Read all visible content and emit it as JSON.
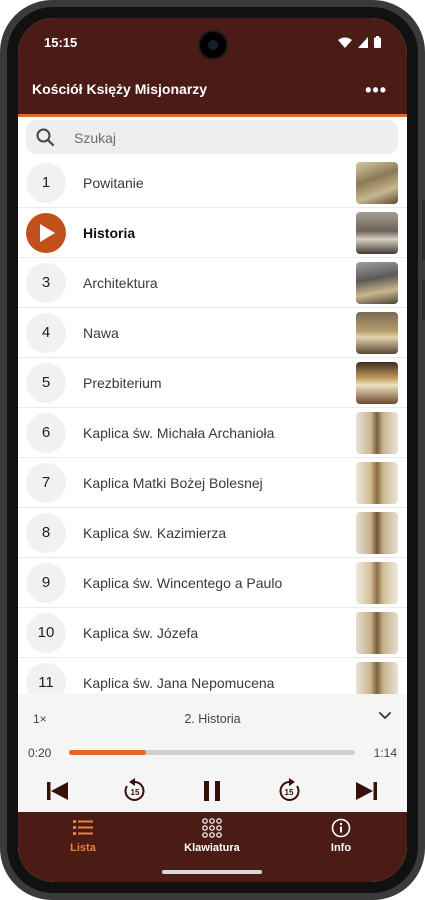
{
  "status_bar": {
    "time": "15:15"
  },
  "app_bar": {
    "title": "Kościół Księży Misjonarzy",
    "more_label": "•••"
  },
  "search": {
    "placeholder": "Szukaj"
  },
  "items": [
    {
      "number": "1",
      "label": "Powitanie",
      "playing": false
    },
    {
      "number": "",
      "label": "Historia",
      "playing": true
    },
    {
      "number": "3",
      "label": "Architektura",
      "playing": false
    },
    {
      "number": "4",
      "label": "Nawa",
      "playing": false
    },
    {
      "number": "5",
      "label": "Prezbiterium",
      "playing": false
    },
    {
      "number": "6",
      "label": "Kaplica św. Michała Archanioła",
      "playing": false
    },
    {
      "number": "7",
      "label": "Kaplica Matki Bożej Bolesnej",
      "playing": false
    },
    {
      "number": "8",
      "label": "Kaplica św. Kazimierza",
      "playing": false
    },
    {
      "number": "9",
      "label": "Kaplica św. Wincentego a Paulo",
      "playing": false
    },
    {
      "number": "10",
      "label": "Kaplica św. Józefa",
      "playing": false
    },
    {
      "number": "11",
      "label": "Kaplica św. Jana Nepomucena",
      "playing": false
    }
  ],
  "player": {
    "speed": "1×",
    "title": "2. Historia",
    "current_time": "0:20",
    "total_time": "1:14",
    "progress": 0.27
  },
  "bottom_nav": {
    "tabs": [
      {
        "label": "Lista",
        "active": true
      },
      {
        "label": "Klawiatura",
        "active": false
      },
      {
        "label": "Info",
        "active": false
      }
    ]
  },
  "colors": {
    "brand": "#4b1c15",
    "accent": "#e0692a",
    "play_button": "#c2501b"
  }
}
